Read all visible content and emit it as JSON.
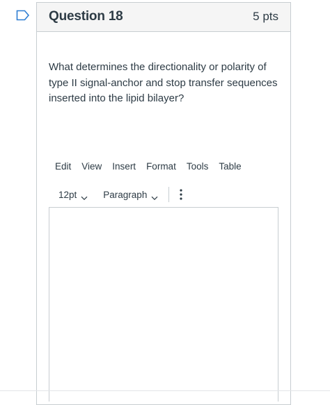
{
  "question": {
    "title": "Question 18",
    "points": "5 pts",
    "text": "What determines the directionality or polarity of type II signal-anchor and stop transfer sequences inserted into the lipid bilayer?"
  },
  "editor": {
    "menu": [
      "Edit",
      "View",
      "Insert",
      "Format",
      "Tools",
      "Table"
    ],
    "font_size": "12pt",
    "block_format": "Paragraph",
    "content": ""
  },
  "icons": {
    "flag": "bookmark-flag-icon",
    "chevron": "chevron-down-icon",
    "more": "more-vertical-icon"
  },
  "colors": {
    "flag": "#2d7dd2",
    "text": "#2d3b45",
    "border": "#c7cdd1",
    "header_bg": "#f5f5f5"
  }
}
